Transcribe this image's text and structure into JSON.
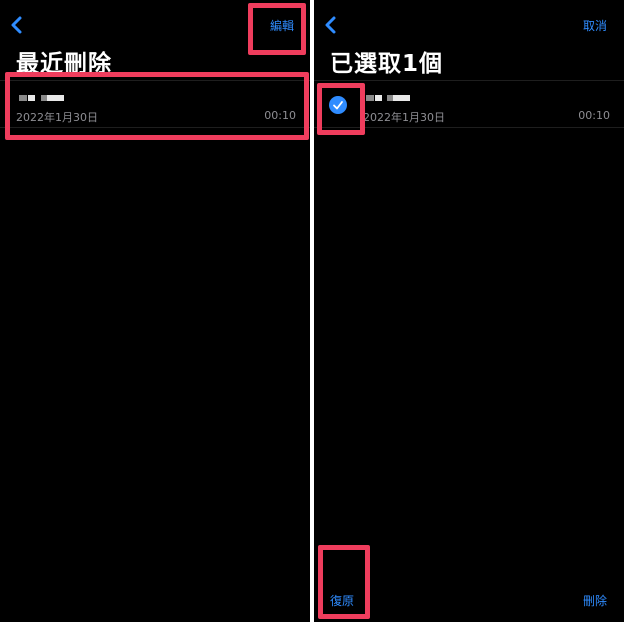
{
  "left_screen": {
    "nav": {
      "edit_label": "編輯"
    },
    "title": "最近刪除",
    "recording": {
      "date": "2022年1月30日",
      "duration": "00:10"
    }
  },
  "right_screen": {
    "nav": {
      "cancel_label": "取消"
    },
    "title": "已選取1個",
    "recording": {
      "date": "2022年1月30日",
      "duration": "00:10",
      "selected": true
    },
    "toolbar": {
      "recover_label": "復原",
      "delete_label": "刪除"
    }
  },
  "colors": {
    "accent": "#2f8cff",
    "highlight": "#ef3d5d",
    "background": "#000000",
    "secondary_text": "#8e8e93"
  },
  "icons": {
    "back": "chevron-left-icon",
    "check": "checkmark-circle-icon"
  }
}
